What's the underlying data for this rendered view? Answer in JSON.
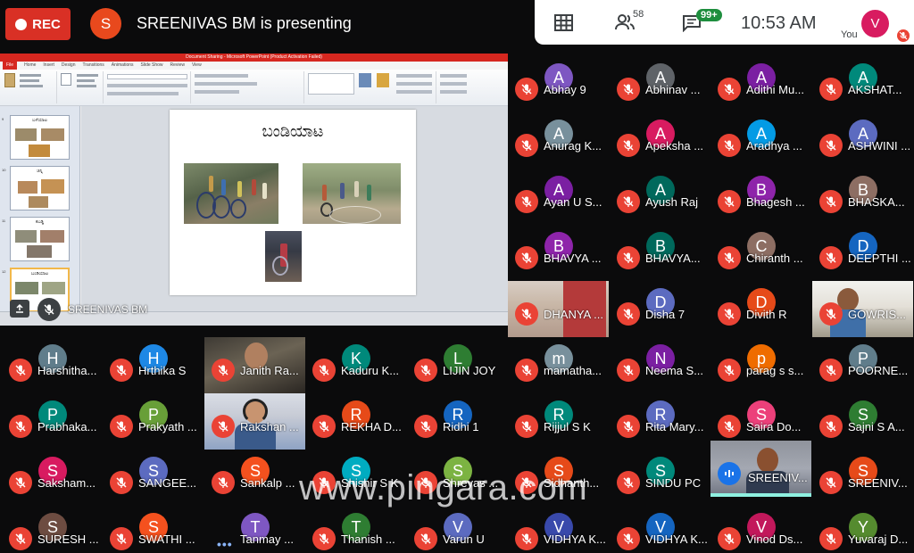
{
  "recording": {
    "label": "REC",
    "color": "#d93025"
  },
  "presenter": {
    "initial": "S",
    "text": "SREENIVAS BM is presenting",
    "color": "#e8491d"
  },
  "topbar": {
    "grid_icon": "grid-icon",
    "people_icon": "people-icon",
    "people_count": "58",
    "chat_icon": "chat-icon",
    "chat_badge": "99+",
    "time": "10:53  AM",
    "self_initial": "V",
    "self_label": "You",
    "self_color": "#d81b60"
  },
  "presentation": {
    "window_title": "Document Sharing - Microsoft PowerPoint (Product Activation Failed)",
    "tabs": [
      "File",
      "Home",
      "Insert",
      "Design",
      "Transitions",
      "Animations",
      "Slide Show",
      "Review",
      "View"
    ],
    "slide_title": "ಬಂಡಿಯಾಟ",
    "thumb_titles": [
      "ಬಳೆಯಾಟ",
      "ಚಿನ್ನಿ",
      "ಕಬಡ್ಡಿ",
      "ಬಂಡಿಯಾಟ"
    ],
    "thumb_numbers": [
      "9",
      "10",
      "11",
      "12"
    ],
    "presenter_name": "SREENIVAS BM"
  },
  "participants": [
    {
      "initial": "A",
      "name": "Abhay 9",
      "color": "#7e57c2"
    },
    {
      "initial": "A",
      "name": "Abhinav ...",
      "color": "#5f6368"
    },
    {
      "initial": "A",
      "name": "Adithi Mu...",
      "color": "#7b1fa2"
    },
    {
      "initial": "A",
      "name": "AKSHAT...",
      "color": "#00897b"
    },
    {
      "initial": "A",
      "name": "Anurag K...",
      "color": "#78909c"
    },
    {
      "initial": "A",
      "name": "Apeksha ...",
      "color": "#d81b60"
    },
    {
      "initial": "A",
      "name": "Aradhya ...",
      "color": "#039be5"
    },
    {
      "initial": "A",
      "name": "ASHWINI ...",
      "color": "#5c6bc0"
    },
    {
      "initial": "A",
      "name": "Ayan U S...",
      "color": "#7b1fa2"
    },
    {
      "initial": "A",
      "name": "Ayush Raj",
      "color": "#00695c"
    },
    {
      "initial": "B",
      "name": "Bhagesh ...",
      "color": "#8e24aa"
    },
    {
      "initial": "B",
      "name": "BHASKA...",
      "color": "#8d6e63"
    },
    {
      "initial": "B",
      "name": "BHAVYA ...",
      "color": "#8e24aa"
    },
    {
      "initial": "B",
      "name": "BHAVYA...",
      "color": "#00695c"
    },
    {
      "initial": "C",
      "name": "Chiranth ...",
      "color": "#8d6e63"
    },
    {
      "initial": "D",
      "name": "DEEPTHI ...",
      "color": "#1565c0"
    },
    {
      "initial": "",
      "name": "DHANYA ...",
      "color": "",
      "video": "v1"
    },
    {
      "initial": "D",
      "name": "Disha 7",
      "color": "#5c6bc0"
    },
    {
      "initial": "D",
      "name": "Divith R",
      "color": "#e64a19"
    },
    {
      "initial": "",
      "name": "GOWRIS...",
      "color": "",
      "video": "v2"
    },
    {
      "initial": "H",
      "name": "Harshitha...",
      "color": "#607d8b"
    },
    {
      "initial": "H",
      "name": "Hrthika S",
      "color": "#1e88e5"
    },
    {
      "initial": "",
      "name": "Janith Ra...",
      "color": "",
      "video": "v3"
    },
    {
      "initial": "K",
      "name": "Kaduru K...",
      "color": "#00897b"
    },
    {
      "initial": "L",
      "name": "LIJIN JOY",
      "color": "#2e7d32"
    },
    {
      "initial": "m",
      "name": "mamatha...",
      "color": "#78909c"
    },
    {
      "initial": "N",
      "name": "Neema S...",
      "color": "#7b1fa2"
    },
    {
      "initial": "p",
      "name": "parag s s...",
      "color": "#ef6c00"
    },
    {
      "initial": "P",
      "name": "POORNE...",
      "color": "#607d8b"
    },
    {
      "initial": "P",
      "name": "Prabhaka...",
      "color": "#00897b"
    },
    {
      "initial": "P",
      "name": "Prakyath ...",
      "color": "#689f38"
    },
    {
      "initial": "",
      "name": "Rakshan ...",
      "color": "",
      "video": "v4"
    },
    {
      "initial": "R",
      "name": "REKHA D...",
      "color": "#e64a19"
    },
    {
      "initial": "R",
      "name": "Ridhi 1",
      "color": "#1565c0"
    },
    {
      "initial": "R",
      "name": "Rijjul S K",
      "color": "#00897b"
    },
    {
      "initial": "R",
      "name": "Rita Mary...",
      "color": "#5c6bc0"
    },
    {
      "initial": "S",
      "name": "Saira Do...",
      "color": "#ec407a"
    },
    {
      "initial": "S",
      "name": "Sajni S A...",
      "color": "#2e7d32"
    },
    {
      "initial": "S",
      "name": "Saksham...",
      "color": "#d81b60"
    },
    {
      "initial": "S",
      "name": "SANGEE...",
      "color": "#5c6bc0"
    },
    {
      "initial": "S",
      "name": "Sankalp ...",
      "color": "#f4511e"
    },
    {
      "initial": "S",
      "name": "Shishir S K",
      "color": "#00acc1"
    },
    {
      "initial": "S",
      "name": "Shreyas ...",
      "color": "#7cb342"
    },
    {
      "initial": "S",
      "name": "Sidhanth...",
      "color": "#e64a19"
    },
    {
      "initial": "S",
      "name": "SINDU PC",
      "color": "#00897b"
    },
    {
      "initial": "",
      "name": "SREENIV...",
      "color": "",
      "video": "v5",
      "speaking": true
    },
    {
      "initial": "S",
      "name": "SREENIV...",
      "color": "#e64a19"
    },
    {
      "initial": "S",
      "name": "SURESH ...",
      "color": "#6d4c41"
    },
    {
      "initial": "S",
      "name": "SWATHI ...",
      "color": "#f4511e"
    },
    {
      "initial": "T",
      "name": "Tanmay ...",
      "color": "#7e57c2",
      "dots": true
    },
    {
      "initial": "T",
      "name": "Thanish ...",
      "color": "#2e7d32"
    },
    {
      "initial": "V",
      "name": "Varun U",
      "color": "#5c6bc0"
    },
    {
      "initial": "V",
      "name": "VIDHYA K...",
      "color": "#3949ab"
    },
    {
      "initial": "V",
      "name": "VIDHYA K...",
      "color": "#1565c0"
    },
    {
      "initial": "V",
      "name": "Vinod Ds...",
      "color": "#c2185b"
    },
    {
      "initial": "Y",
      "name": "Yuvaraj D...",
      "color": "#558b2f"
    }
  ],
  "watermark": "www.pingara.com"
}
